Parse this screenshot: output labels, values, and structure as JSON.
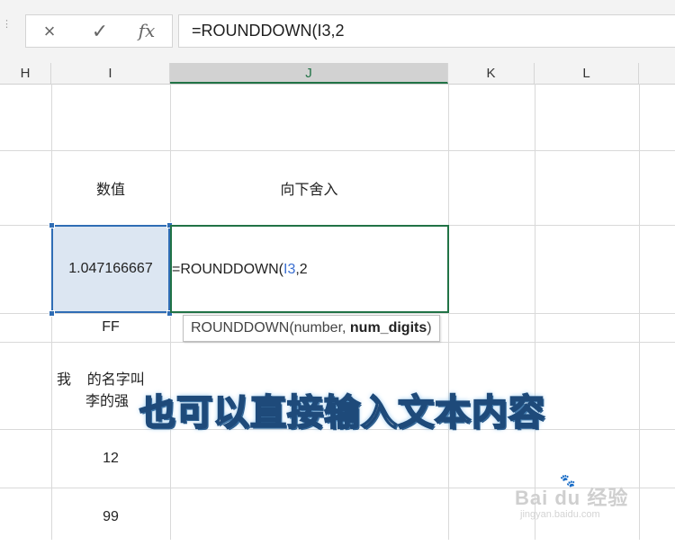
{
  "formula_bar": {
    "cancel_icon": "×",
    "enter_icon": "✓",
    "fx_label": "fx",
    "formula_text": "=ROUNDDOWN(I3,2"
  },
  "columns": [
    "H",
    "I",
    "J",
    "K",
    "L"
  ],
  "selected_column": "J",
  "cells": {
    "i_header": "数值",
    "j_header": "向下舍入",
    "i_value": "1.047166667",
    "i_text1": "FF",
    "i_text2_line1": "我    的名字叫",
    "i_text2_line2": "李的强",
    "i_num1": "12",
    "i_num2": "99"
  },
  "edit_cell": {
    "prefix": "=ROUNDDOWN(",
    "ref": "I3",
    "suffix": ",2"
  },
  "tooltip": {
    "func": "ROUNDDOWN(number, ",
    "active_arg": "num_digits",
    "close": ")"
  },
  "overlay_caption": "也可以直接输入文本内容",
  "watermark": {
    "brand": "Bai du 经验",
    "url": "jingyan.baidu.com"
  },
  "colors": {
    "selection_blue": "#2f6db5",
    "edit_green": "#217346",
    "ref_blue": "#3b6fd1"
  }
}
